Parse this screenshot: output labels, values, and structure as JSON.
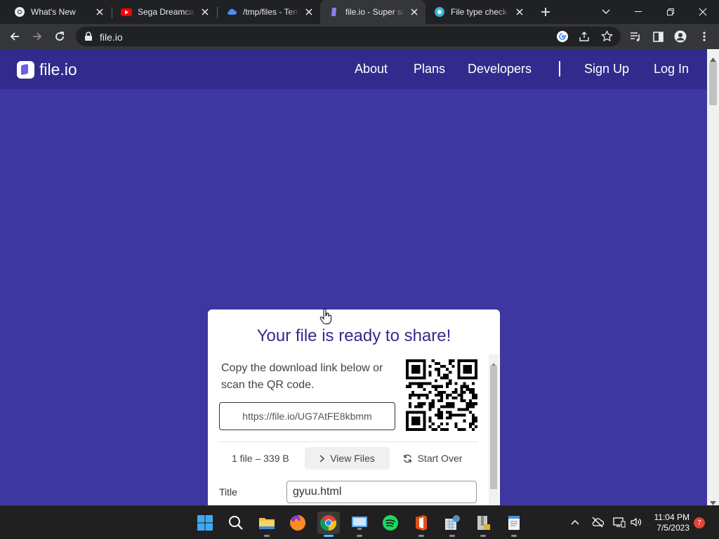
{
  "browser": {
    "tabs": [
      {
        "title": "What's New",
        "icon": "chrome-icon",
        "active": false
      },
      {
        "title": "Sega Dreamcast",
        "icon": "youtube-icon",
        "active": false
      },
      {
        "title": "/tmp/files - Tem",
        "icon": "cloud-icon",
        "active": false
      },
      {
        "title": "file.io - Super sim",
        "icon": "fileio-icon",
        "active": true
      },
      {
        "title": "File type check",
        "icon": "checker-icon",
        "active": false
      }
    ],
    "url": "file.io"
  },
  "site": {
    "brand": "file.io",
    "nav": {
      "about": "About",
      "plans": "Plans",
      "developers": "Developers",
      "signup": "Sign Up",
      "login": "Log In"
    }
  },
  "card": {
    "title": "Your file is ready to share!",
    "description": "Copy the download link below or scan the QR code.",
    "link": "https://file.io/UG7AtFE8kbmm",
    "file_info": "1 file – 339 B",
    "view_files": "View Files",
    "start_over": "Start Over",
    "title_label": "Title",
    "title_value": "gyuu.html"
  },
  "taskbar": {
    "time": "11:04 PM",
    "date": "7/5/2023",
    "notifications": "7"
  },
  "colors": {
    "brand_dark": "#322b8d",
    "brand_bg": "#3e37a0",
    "accent": "#6e5fe6"
  }
}
